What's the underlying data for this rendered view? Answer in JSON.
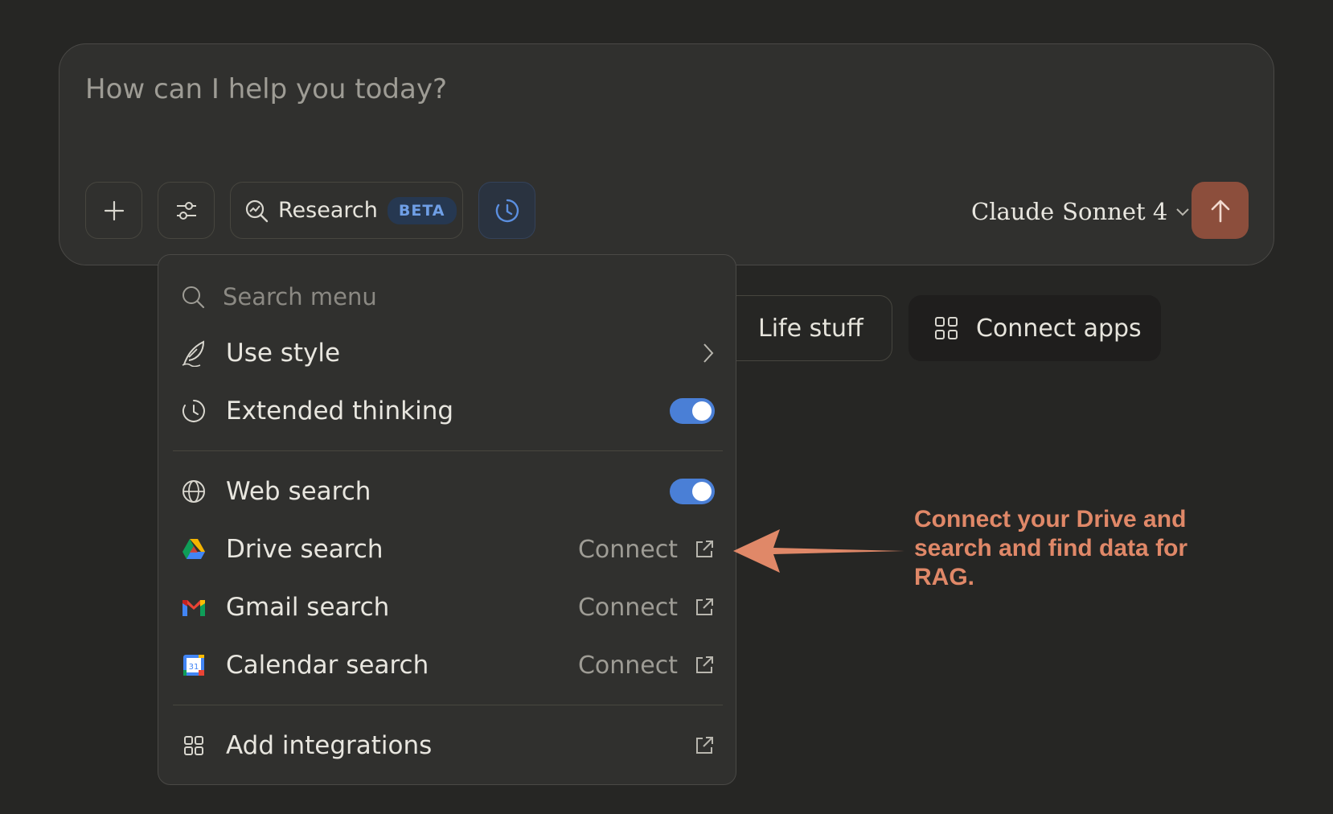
{
  "composer": {
    "placeholder": "How can I help you today?",
    "research_label": "Research",
    "research_badge": "BETA",
    "model_brand": "Claude",
    "model_name": "Sonnet 4",
    "send_icon": "arrow-up-icon"
  },
  "chips": {
    "life_stuff": "Life stuff",
    "connect_apps": "Connect apps"
  },
  "menu": {
    "search_placeholder": "Search menu",
    "items": [
      {
        "label": "Use style",
        "icon": "feather-icon",
        "right": "chevron-right-icon"
      },
      {
        "label": "Extended thinking",
        "icon": "clock-icon",
        "toggle": true
      },
      {
        "label": "Web search",
        "icon": "globe-icon",
        "toggle": true
      },
      {
        "label": "Drive search",
        "icon": "google-drive-icon",
        "action": "Connect"
      },
      {
        "label": "Gmail search",
        "icon": "gmail-icon",
        "action": "Connect"
      },
      {
        "label": "Calendar search",
        "icon": "google-calendar-icon",
        "action": "Connect"
      },
      {
        "label": "Add integrations",
        "icon": "grid-icon",
        "right": "external-link-icon"
      }
    ]
  },
  "annotation": {
    "text": "Connect your Drive and search and find data for RAG.",
    "color": "#e08868"
  },
  "colors": {
    "background": "#262624",
    "surface": "#30302e",
    "accent_blue": "#4a7fd6",
    "send_button": "#8c4e3c"
  }
}
